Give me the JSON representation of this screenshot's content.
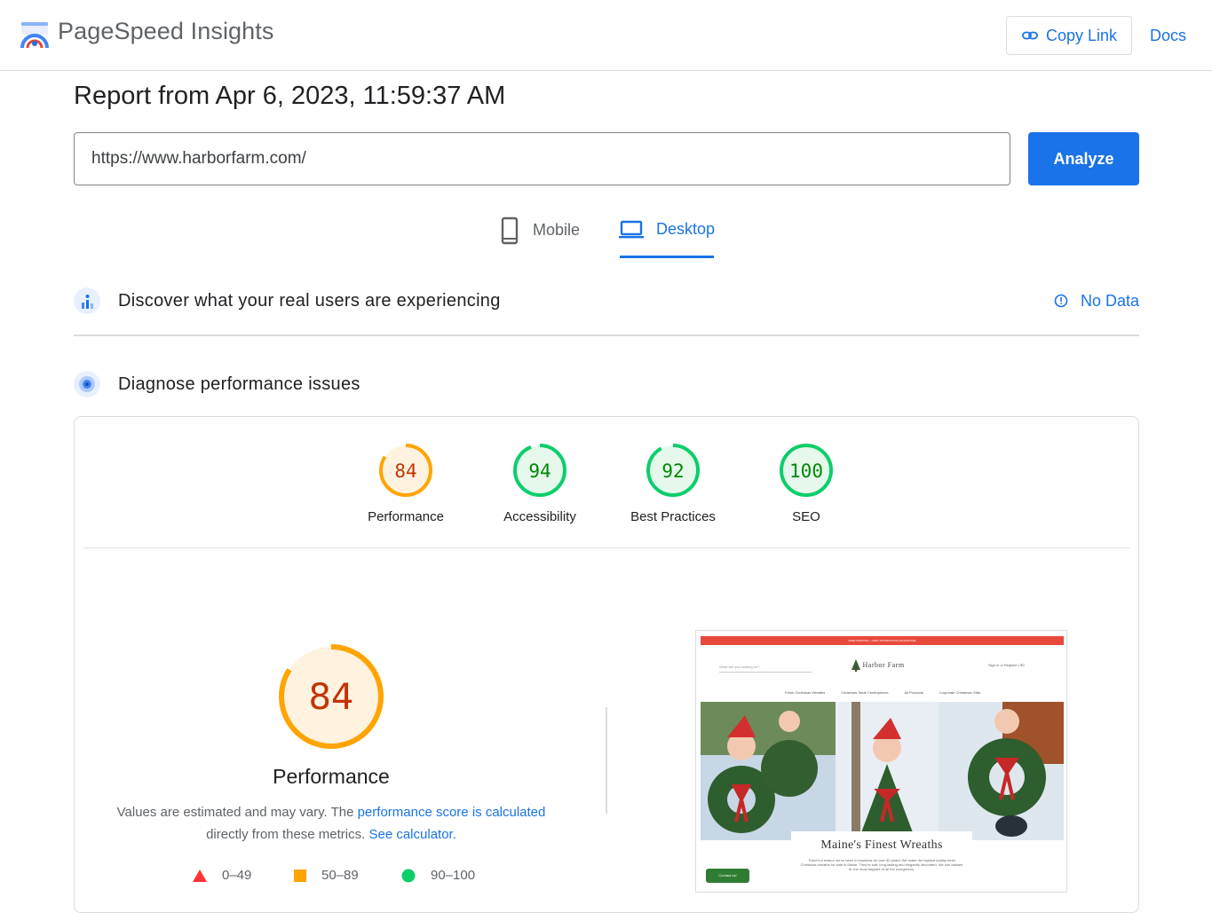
{
  "header": {
    "app_name": "PageSpeed Insights",
    "copy_link_label": "Copy Link",
    "docs_label": "Docs"
  },
  "report": {
    "title": "Report from Apr 6, 2023, 11:59:37 AM",
    "url_value": "https://www.harborfarm.com/",
    "analyze_label": "Analyze"
  },
  "tabs": [
    {
      "label": "Mobile",
      "icon": "smartphone-icon",
      "selected": false
    },
    {
      "label": "Desktop",
      "icon": "laptop-icon",
      "selected": true
    }
  ],
  "sections": {
    "field_data": {
      "title": "Discover what your real users are experiencing",
      "status": "No Data"
    },
    "lab_data": {
      "title": "Diagnose performance issues"
    }
  },
  "scores": [
    {
      "label": "Performance",
      "value": "84",
      "score": 84,
      "color": "#ffa400",
      "fill": "#fff3e0",
      "text_color": "#c33300"
    },
    {
      "label": "Accessibility",
      "value": "94",
      "score": 94,
      "color": "#0cce6b",
      "fill": "#e6f8ec",
      "text_color": "#008800"
    },
    {
      "label": "Best Practices",
      "value": "92",
      "score": 92,
      "color": "#0cce6b",
      "fill": "#e6f8ec",
      "text_color": "#008800"
    },
    {
      "label": "SEO",
      "value": "100",
      "score": 100,
      "color": "#0cce6b",
      "fill": "#e6f8ec",
      "text_color": "#008800"
    }
  ],
  "performance_detail": {
    "score": "84",
    "label": "Performance",
    "desc_prefix": "Values are estimated and may vary. The ",
    "desc_link1": "performance score is calculated",
    "desc_middle": " directly from these metrics. ",
    "desc_link2": "See calculator."
  },
  "legend": [
    {
      "range": "0–49",
      "shape": "triangle",
      "color": "#ff3333"
    },
    {
      "range": "50–89",
      "shape": "square",
      "color": "#ffa400"
    },
    {
      "range": "90–100",
      "shape": "circle",
      "color": "#0cce6b"
    }
  ],
  "screenshot": {
    "banner": "FREE SHIPPING + 100% SATISFACTION GUARANTEE",
    "search_placeholder": "What are you looking for?",
    "brand": "Harbor Farm",
    "account": "Sign in or Register  |  $0",
    "nav": [
      "Fresh Christmas Wreaths",
      "Christmas Table Centerpieces",
      "All Products",
      "Corporate Christmas Gifts"
    ],
    "caption_title": "Maine's Finest Wreaths",
    "caption_body": "There's a reason we've been in business for over 50 years! We make the highest quality fresh Christmas wreaths for sale in Maine. They're soft, long-lasting and elegantly decorated. We use balsam fir, the most fragrant of all the evergreens.",
    "contact_label": "Contact us!"
  }
}
